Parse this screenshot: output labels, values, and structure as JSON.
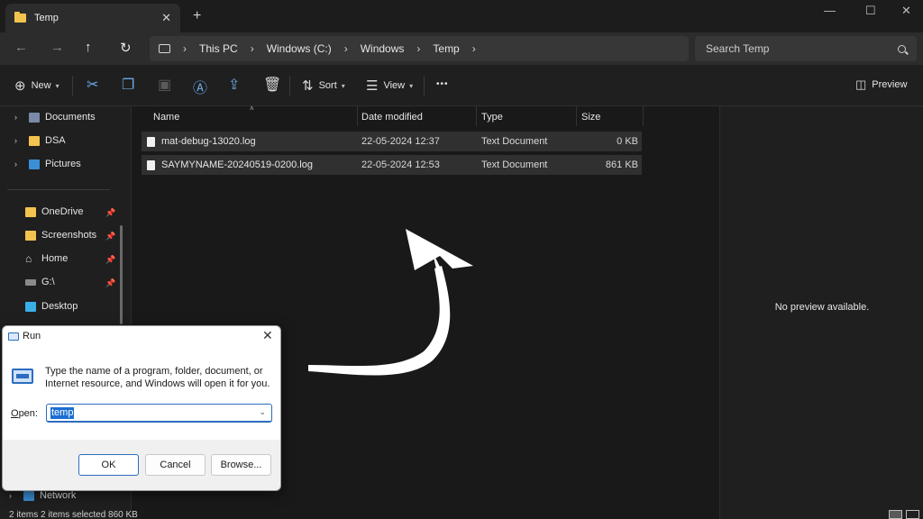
{
  "window": {
    "tab_title": "Temp",
    "tab_close": "✕",
    "new_tab": "+",
    "minimize": "—",
    "maximize": "☐",
    "close": "✕"
  },
  "nav": {
    "back": "←",
    "forward": "→",
    "up": "↑",
    "refresh": "↻"
  },
  "address": {
    "crumbs": [
      "This PC",
      "Windows (C:)",
      "Windows",
      "Temp"
    ],
    "separator": "›"
  },
  "search": {
    "placeholder": "Search Temp"
  },
  "toolbar": {
    "new_label": "New",
    "sort_label": "Sort",
    "view_label": "View",
    "more": "•••",
    "preview_label": "Preview",
    "icons": [
      "cut-icon",
      "copy-icon",
      "paste-icon",
      "rename-icon",
      "share-icon",
      "delete-icon"
    ]
  },
  "sidebar": {
    "top_items": [
      {
        "label": "Documents",
        "icon": "documents-icon"
      },
      {
        "label": "DSA",
        "icon": "folder-icon"
      },
      {
        "label": "Pictures",
        "icon": "pictures-icon"
      }
    ],
    "pinned_items": [
      {
        "label": "OneDrive",
        "icon": "folder-icon"
      },
      {
        "label": "Screenshots",
        "icon": "folder-icon"
      },
      {
        "label": "Home",
        "icon": "home-icon"
      },
      {
        "label": "G:\\",
        "icon": "drive-icon"
      },
      {
        "label": "Desktop",
        "icon": "desktop-icon"
      }
    ],
    "network_label": "Network"
  },
  "table": {
    "columns": [
      "Name",
      "Date modified",
      "Type",
      "Size"
    ],
    "rows": [
      {
        "name": "mat-debug-13020.log",
        "date": "22-05-2024 12:37",
        "type": "Text Document",
        "size": "0 KB"
      },
      {
        "name": "SAYMYNAME-20240519-0200.log",
        "date": "22-05-2024 12:53",
        "type": "Text Document",
        "size": "861 KB"
      }
    ]
  },
  "preview": {
    "message": "No preview available."
  },
  "status": {
    "text": "2 items    2 items selected  860 KB"
  },
  "run_dialog": {
    "title": "Run",
    "close": "✕",
    "description": "Type the name of a program, folder, document, or Internet resource, and Windows will open it for you.",
    "open_label_underlined": "O",
    "open_label_rest": "pen:",
    "value": "temp",
    "ok_label": "OK",
    "cancel_label": "Cancel",
    "browse_label": "Browse...",
    "accent": "#2d6cc0"
  }
}
